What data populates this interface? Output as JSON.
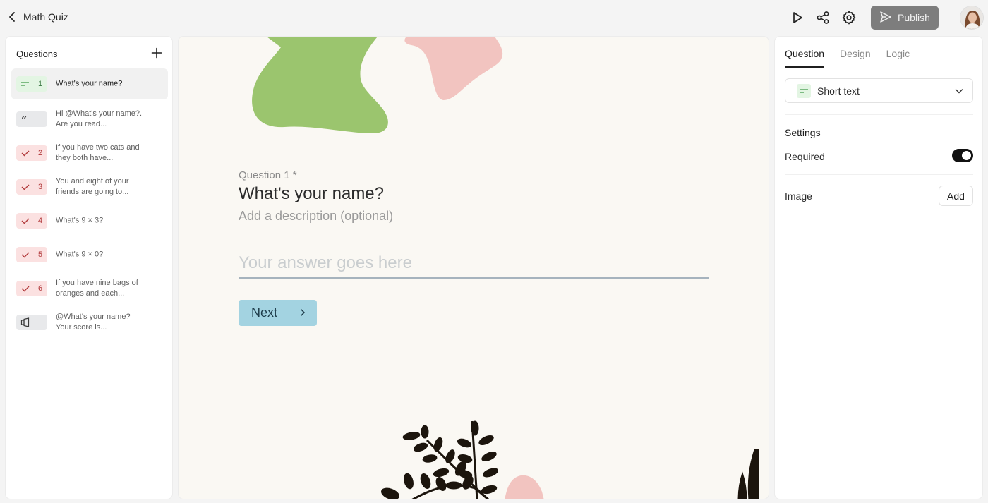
{
  "header": {
    "title": "Math Quiz",
    "publish_label": "Publish",
    "icons": [
      "back-chevron-icon",
      "preview-play-icon",
      "share-icon",
      "settings-gear-icon",
      "send-icon",
      "user-avatar"
    ]
  },
  "questions_panel": {
    "title": "Questions",
    "add_icon": "plus-icon",
    "items": [
      {
        "type": "short-text",
        "number": "1",
        "text": "What's your name?",
        "active": true
      },
      {
        "type": "statement",
        "number": "",
        "text": "Hi @What's your name?. Are you read..."
      },
      {
        "type": "multiple-choice",
        "number": "2",
        "text": "If you have two cats and they both have..."
      },
      {
        "type": "multiple-choice",
        "number": "3",
        "text": "You and eight of your friends are going to..."
      },
      {
        "type": "multiple-choice",
        "number": "4",
        "text": "What's 9 × 3?"
      },
      {
        "type": "multiple-choice",
        "number": "5",
        "text": "What's 9 × 0?"
      },
      {
        "type": "multiple-choice",
        "number": "6",
        "text": "If you have nine bags of oranges and each..."
      },
      {
        "type": "ending",
        "number": "",
        "text": "@What's your name? Your score is..."
      }
    ]
  },
  "canvas": {
    "question_label": "Question 1 *",
    "question_title": "What's your name?",
    "description_placeholder": "Add a description (optional)",
    "answer_placeholder": "Your answer goes here",
    "next_label": "Next",
    "colors": {
      "background": "#faf8f3",
      "green_blob": "#9bc56e",
      "pink_blob": "#f2c4c0",
      "plant": "#1c150d",
      "button": "#a3d3e1"
    }
  },
  "right_panel": {
    "tabs": [
      {
        "label": "Question",
        "active": true
      },
      {
        "label": "Design",
        "active": false
      },
      {
        "label": "Logic",
        "active": false
      }
    ],
    "question_type": "Short text",
    "settings_title": "Settings",
    "required_label": "Required",
    "required_on": true,
    "image_label": "Image",
    "add_label": "Add"
  }
}
